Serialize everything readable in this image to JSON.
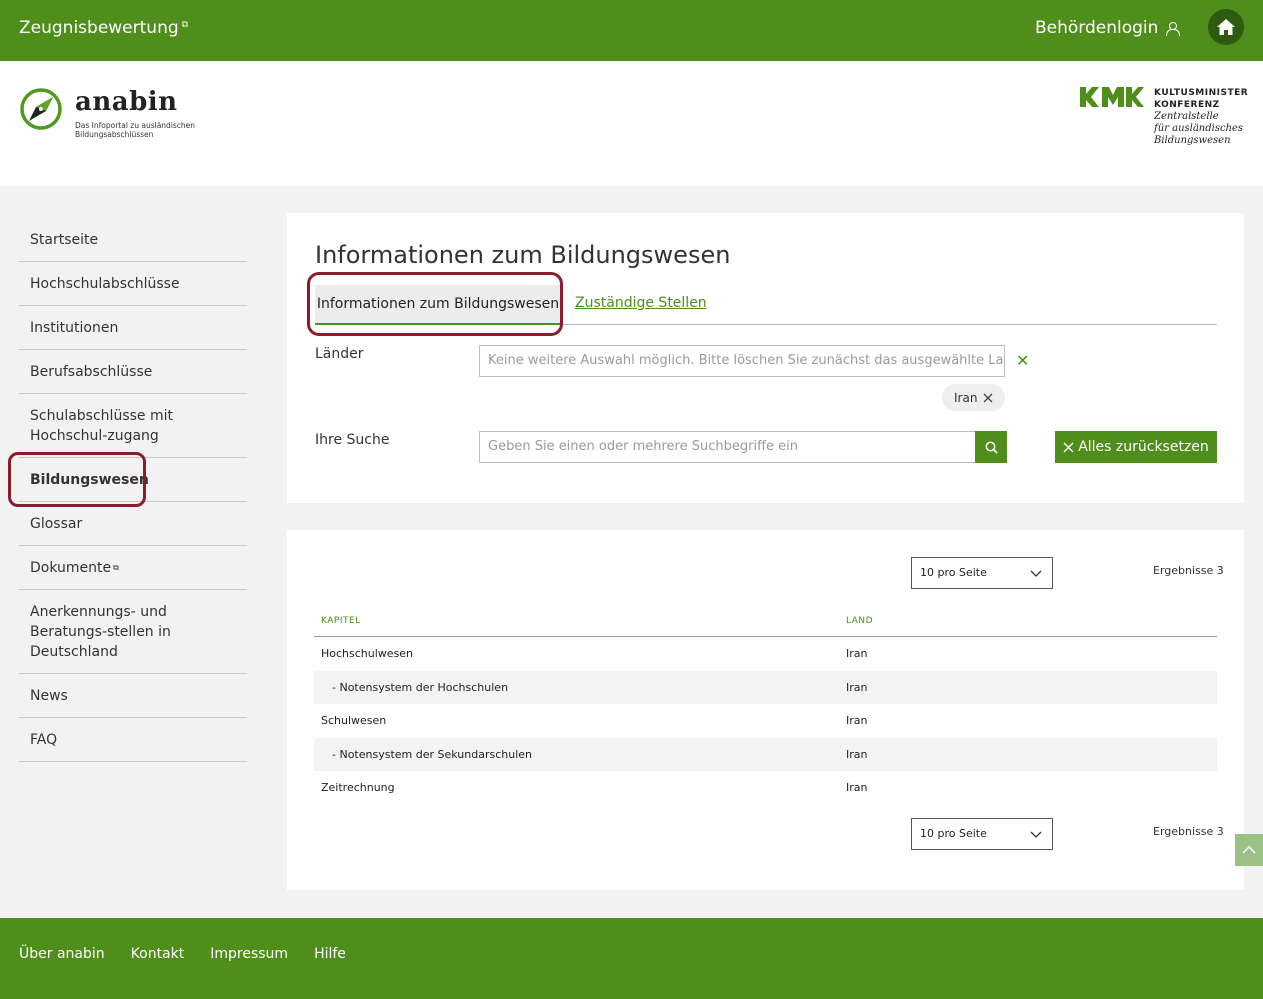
{
  "topbar": {
    "brand": "Zeugnisbewertung",
    "login": "Behördenlogin"
  },
  "header": {
    "logo_name": "anabin",
    "logo_sub": "Das Infoportal zu ausländischen Bildungsabschlüssen",
    "kmk_line1": "KULTUSMINISTER",
    "kmk_line2": "KONFERENZ",
    "kmk_line3": "Zentralstelle",
    "kmk_line4": "für ausländisches",
    "kmk_line5": "Bildungswesen"
  },
  "sidebar": {
    "items": [
      {
        "label": "Startseite"
      },
      {
        "label": "Hochschulabschlüsse"
      },
      {
        "label": "Institutionen"
      },
      {
        "label": "Berufsabschlüsse"
      },
      {
        "label": "Schulabschlüsse mit Hochschul-zugang"
      },
      {
        "label": "Bildungswesen"
      },
      {
        "label": "Glossar"
      },
      {
        "label": "Dokumente"
      },
      {
        "label": "Anerkennungs- und Beratungs-stellen in Deutschland"
      },
      {
        "label": "News"
      },
      {
        "label": "FAQ"
      }
    ]
  },
  "main": {
    "title": "Informationen zum Bildungswesen",
    "tabs": [
      {
        "label": "Informationen zum Bildungswesen"
      },
      {
        "label": "Zuständige Stellen"
      }
    ],
    "laender_label": "Länder",
    "laender_placeholder": "Keine weitere Auswahl möglich. Bitte löschen Sie zunächst das ausgewählte Land!",
    "chip": "Iran",
    "suche_label": "Ihre Suche",
    "suche_placeholder": "Geben Sie einen oder mehrere Suchbegriffe ein",
    "reset_label": "Alles zurücksetzen"
  },
  "results": {
    "per_page": "10 pro Seite",
    "count": "Ergebnisse 3",
    "columns": [
      "KAPITEL",
      "LAND"
    ],
    "rows": [
      {
        "kapitel": "Hochschulwesen",
        "land": "Iran"
      },
      {
        "kapitel": "- Notensystem der Hochschulen",
        "land": "Iran"
      },
      {
        "kapitel": "Schulwesen",
        "land": "Iran"
      },
      {
        "kapitel": "- Notensystem der Sekundarschulen",
        "land": "Iran"
      },
      {
        "kapitel": "Zeitrechnung",
        "land": "Iran"
      }
    ]
  },
  "footer": {
    "links": [
      "Über anabin",
      "Kontakt",
      "Impressum",
      "Hilfe"
    ]
  },
  "colors": {
    "brand_green": "#4f8e1b",
    "highlight": "#8a1d2c"
  }
}
